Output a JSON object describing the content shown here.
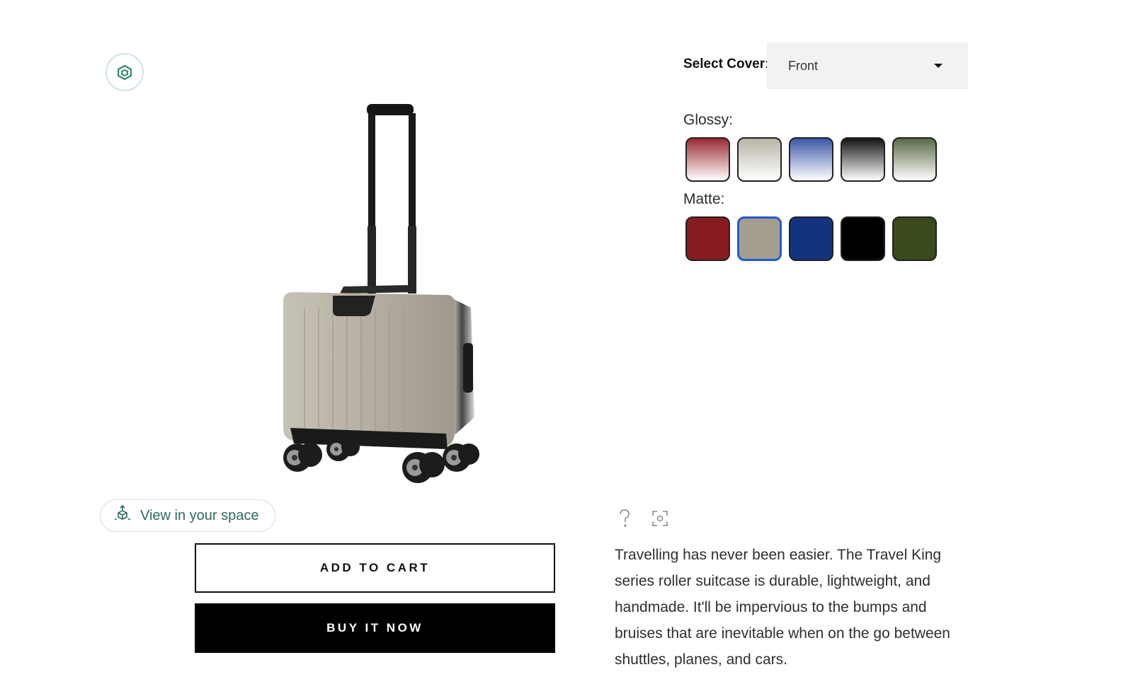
{
  "view_in_space": {
    "label": "View in your space"
  },
  "actions": {
    "add_to_cart": "ADD TO CART",
    "buy_it_now": "BUY IT NOW"
  },
  "cover_select": {
    "label": "Select Cover:",
    "value": "Front"
  },
  "finishes": {
    "glossy": {
      "label": "Glossy:",
      "swatches": [
        "#9b2b32",
        "#b7b3a6",
        "#3b59a8",
        "#141414",
        "#5a6a45"
      ]
    },
    "matte": {
      "label": "Matte:",
      "swatches": [
        "#861c1f",
        "#a59d8f",
        "#14337f",
        "#000000",
        "#3a4a1d"
      ],
      "selected": 1
    }
  },
  "product": {
    "description": "Travelling has never been easier. The Travel King series roller suitcase is durable, lightweight, and handmade. It'll be impervious to the bumps and bruises that are inevitable when on the go between shuttles, planes, and cars."
  },
  "colors": {
    "accent_green": "#2f6b57",
    "selected_outline": "#1f5bd6"
  }
}
